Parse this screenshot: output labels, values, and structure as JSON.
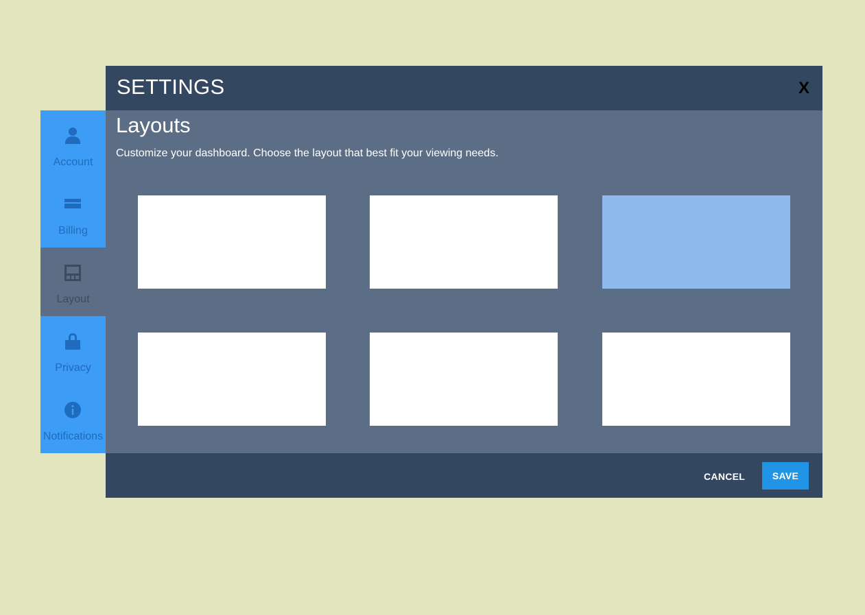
{
  "modal": {
    "title": "SETTINGS",
    "close_label": "X"
  },
  "section": {
    "title": "Layouts",
    "description": "Customize your dashboard. Choose the layout that best fit your viewing needs."
  },
  "layout_options": {
    "selected_index": 2,
    "count": 6
  },
  "sidebar": {
    "items": [
      {
        "label": "Account",
        "icon": "user-icon"
      },
      {
        "label": "Billing",
        "icon": "credit-card-icon"
      },
      {
        "label": "Layout",
        "icon": "layout-icon",
        "active": true
      },
      {
        "label": "Privacy",
        "icon": "lock-icon"
      },
      {
        "label": "Notifications",
        "icon": "info-icon"
      }
    ]
  },
  "footer": {
    "cancel_label": "CANCEL",
    "save_label": "SAVE"
  },
  "colors": {
    "background": "#e2e5bd",
    "header": "#334760",
    "panel": "#5c6e86",
    "sidebar": "#3d9cf5",
    "selected_layout": "#8fbaed",
    "save_button": "#2294e6"
  }
}
